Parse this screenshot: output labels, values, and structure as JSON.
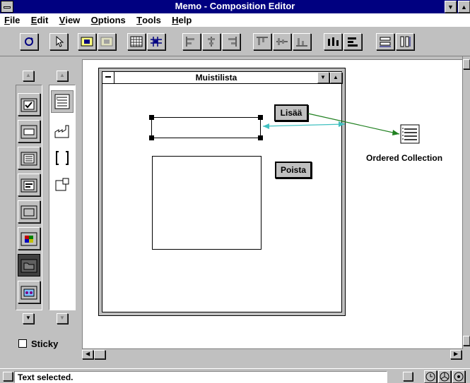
{
  "window": {
    "title": "Memo - Composition Editor"
  },
  "menu": [
    {
      "label": "File",
      "u": "F",
      "rest": "ile"
    },
    {
      "label": "Edit",
      "u": "E",
      "rest": "dit"
    },
    {
      "label": "View",
      "u": "V",
      "rest": "iew"
    },
    {
      "label": "Options",
      "u": "O",
      "rest": "ptions"
    },
    {
      "label": "Tools",
      "u": "T",
      "rest": "ools"
    },
    {
      "label": "Help",
      "u": "H",
      "rest": "elp"
    }
  ],
  "inner_window": {
    "title": "Muistilista"
  },
  "buttons": {
    "add": "Lisää",
    "remove": "Poista"
  },
  "nonvisual_part": {
    "label": "Ordered Collection"
  },
  "palette": {
    "sticky_label": "Sticky"
  },
  "status": {
    "text": "Text selected."
  }
}
